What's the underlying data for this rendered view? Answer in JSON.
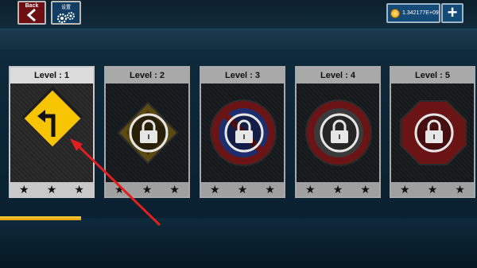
{
  "header": {
    "back_label": "Back",
    "settings_label": "设置",
    "coins_value": "1.342177E+09",
    "add_label": "+"
  },
  "levels": [
    {
      "label": "Level : 1",
      "locked": false,
      "sign": "turn-left-sign",
      "stars": [
        "★",
        "★",
        "★"
      ]
    },
    {
      "label": "Level : 2",
      "locked": true,
      "sign": "diamond-sign",
      "stars": [
        "★",
        "★",
        "★"
      ]
    },
    {
      "label": "Level : 3",
      "locked": true,
      "sign": "no-parking-sign",
      "stars": [
        "★",
        "★",
        "★"
      ]
    },
    {
      "label": "Level : 4",
      "locked": true,
      "sign": "round-sign",
      "stars": [
        "★",
        "★",
        "★"
      ]
    },
    {
      "label": "Level : 5",
      "locked": true,
      "sign": "stop-sign",
      "stars": [
        "★",
        "★",
        "★"
      ]
    }
  ],
  "progress": {
    "fraction": 0.17
  },
  "colors": {
    "accent_yellow": "#f7c400",
    "back_red": "#6d0f12",
    "ui_blue": "#144a78",
    "annotation_red": "#e01f1f"
  }
}
